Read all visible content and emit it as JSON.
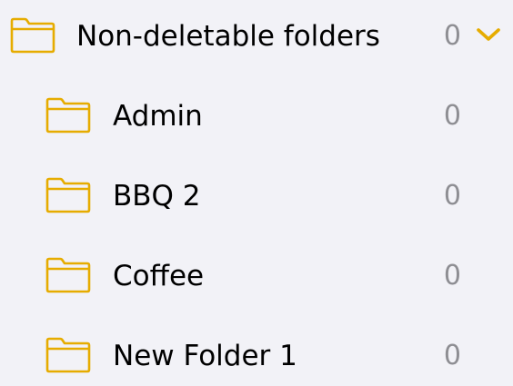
{
  "parent_folder": {
    "label": "Non-deletable folders",
    "count": "0",
    "expanded_icon": "chevron-down-icon",
    "icon": "folder-icon"
  },
  "subfolders": [
    {
      "label": "Admin",
      "count": "0",
      "icon": "folder-icon"
    },
    {
      "label": "BBQ 2",
      "count": "0",
      "icon": "folder-icon"
    },
    {
      "label": "Coffee",
      "count": "0",
      "icon": "folder-icon"
    },
    {
      "label": "New Folder 1",
      "count": "0",
      "icon": "folder-icon"
    }
  ],
  "colors": {
    "accent": "#e6ac00",
    "count_text": "#8e8e93",
    "label_text": "#000000",
    "background": "#f2f2f7"
  }
}
